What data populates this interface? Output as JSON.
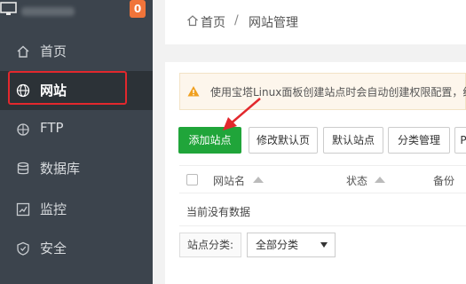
{
  "sidebar": {
    "badge": "0",
    "items": [
      {
        "label": "首页",
        "icon": "home-icon"
      },
      {
        "label": "网站",
        "icon": "globe-icon"
      },
      {
        "label": "FTP",
        "icon": "ftp-icon"
      },
      {
        "label": "数据库",
        "icon": "database-icon"
      },
      {
        "label": "监控",
        "icon": "monitor-chart-icon"
      },
      {
        "label": "安全",
        "icon": "shield-icon"
      }
    ],
    "active_index": 1
  },
  "breadcrumb": {
    "home": "首页",
    "separator": "/",
    "current": "网站管理"
  },
  "notice": {
    "text": "使用宝塔Linux面板创建站点时会自动创建权限配置，统"
  },
  "toolbar": {
    "add_site": "添加站点",
    "edit_default_page": "修改默认页",
    "default_site": "默认站点",
    "category_manage": "分类管理",
    "more": "P"
  },
  "table": {
    "columns": [
      "网站名",
      "状态",
      "备份"
    ],
    "empty_text": "当前没有数据"
  },
  "filter": {
    "label": "站点分类:",
    "selected": "全部分类"
  },
  "colors": {
    "sidebar_bg": "#3c444d",
    "active_bg": "#2c3237",
    "primary": "#20a53a",
    "badge": "#f0743a",
    "highlight": "#e2282d"
  }
}
